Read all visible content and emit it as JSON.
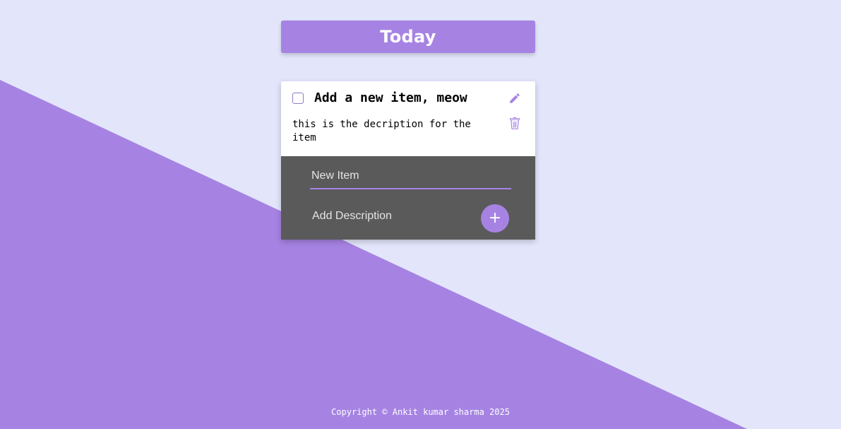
{
  "theme": {
    "background": "#e3e6fb",
    "accent": "#a683e3",
    "form_background": "#5a5a5a"
  },
  "header": {
    "title": "Today"
  },
  "items": [
    {
      "title": "Add a new item, meow",
      "description": "this is the decription for the item",
      "checked": false,
      "edit_icon": "pencil-icon",
      "delete_icon": "trash-icon"
    }
  ],
  "form": {
    "item_placeholder": "New Item",
    "description_placeholder": "Add Description",
    "add_button_label": "+"
  },
  "footer": {
    "copyright": "Copyright © Ankit kumar sharma 2025"
  }
}
